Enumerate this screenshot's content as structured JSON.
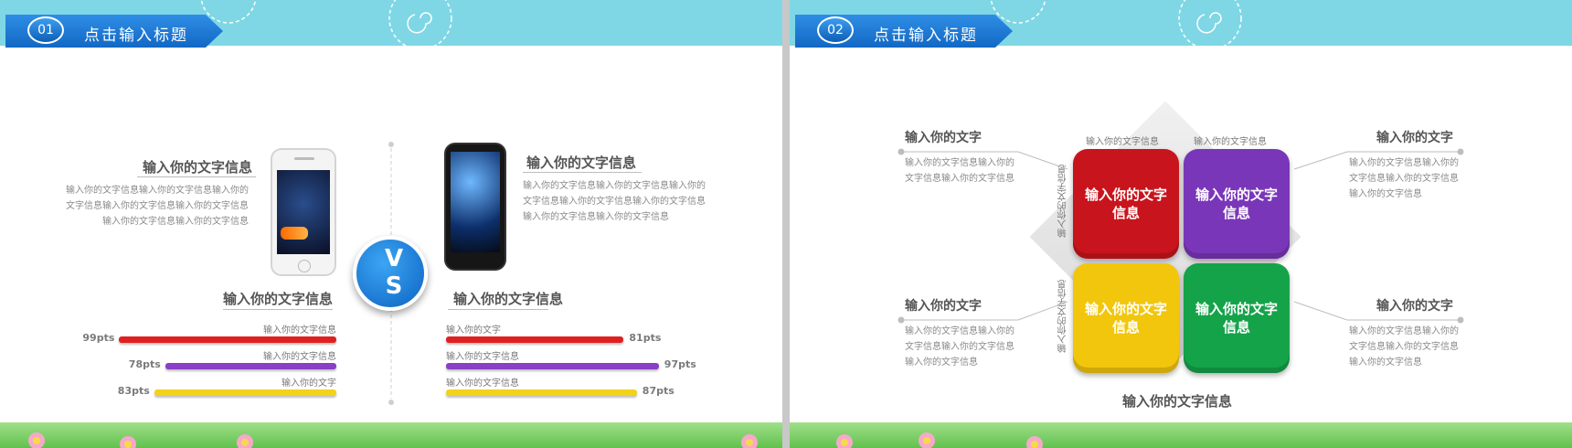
{
  "slide1": {
    "number": "01",
    "title": "点击输入标题",
    "left_heading": "输入你的文字信息",
    "left_body": "输入你的文字信息输入你的文字信息输入你的文字信息输入你的文字信息输入你的文字信息输入你的文字信息输入你的文字信息",
    "right_heading": "输入你的文字信息",
    "right_body": "输入你的文字信息输入你的文字信息输入你的文字信息输入你的文字信息输入你的文字信息输入你的文字信息输入你的文字信息",
    "vs_v": "V",
    "vs_s": "S",
    "left_chart_heading": "输入你的文字信息",
    "right_chart_heading": "输入你的文字信息",
    "left_bars": [
      {
        "label": "输入你的文字信息",
        "value": "99pts",
        "pct": 99,
        "color": "#e02020"
      },
      {
        "label": "输入你的文字信息",
        "value": "78pts",
        "pct": 78,
        "color": "#8a3fc6"
      },
      {
        "label": "输入你的文字",
        "value": "83pts",
        "pct": 83,
        "color": "#f2d21a"
      }
    ],
    "right_bars": [
      {
        "label": "输入你的文字",
        "value": "81pts",
        "pct": 81,
        "color": "#e02020"
      },
      {
        "label": "输入你的文字信息",
        "value": "97pts",
        "pct": 97,
        "color": "#8a3fc6"
      },
      {
        "label": "输入你的文字信息",
        "value": "87pts",
        "pct": 87,
        "color": "#f2d21a"
      }
    ]
  },
  "slide2": {
    "number": "02",
    "title": "点击输入标题",
    "tiles": [
      {
        "text": "输入你的文字信息",
        "color": "#c8141c"
      },
      {
        "text": "输入你的文字信息",
        "color": "#7a36b8"
      },
      {
        "text": "输入你的文字信息",
        "color": "#f2c60c"
      },
      {
        "text": "输入你的文字信息",
        "color": "#15a34a"
      }
    ],
    "top_label_left": "输入你的文字信息",
    "top_label_right": "输入你的文字信息",
    "vert_label_top": "输入你的文字信息",
    "vert_label_bottom": "输入你的文字信息",
    "bottom_label": "输入你的文字信息",
    "sides": [
      {
        "heading": "输入你的文字",
        "body": "输入你的文字信息输入你的文字信息输入你的文字信息"
      },
      {
        "heading": "输入你的文字",
        "body": "输入你的文字信息输入你的文字信息输入你的文字信息输入你的文字信息"
      },
      {
        "heading": "输入你的文字",
        "body": "输入你的文字信息输入你的文字信息输入你的文字信息输入你的文字信息"
      },
      {
        "heading": "输入你的文字",
        "body": "输入你的文字信息输入你的文字信息输入你的文字信息输入你的文字信息"
      }
    ]
  }
}
